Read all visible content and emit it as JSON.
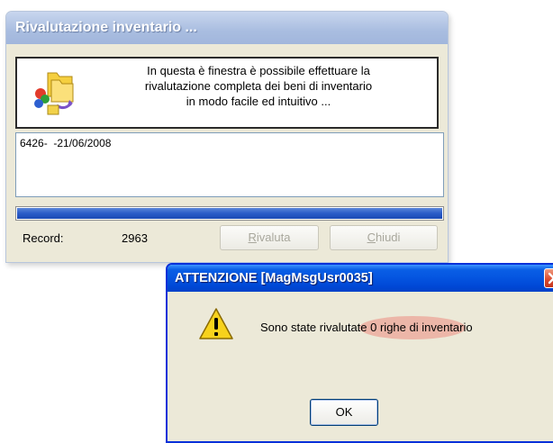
{
  "main_window": {
    "title": "Rivalutazione inventario ...",
    "info_line1": "In questa è finestra è possibile effettuare la",
    "info_line2": "rivalutazione completa dei beni di inventario",
    "info_line3": "in modo facile ed intuitivo ...",
    "info_icon": "folders-wizard-icon",
    "log_text": "6426-  -21/06/2008",
    "progress_fraction": 1.0,
    "record_label": "Record:",
    "record_value": "2963",
    "rivaluta_underlined": "R",
    "rivaluta_rest": "ivaluta",
    "chiudi_underlined": "C",
    "chiudi_rest": "hiudi"
  },
  "dialog": {
    "title": "ATTENZIONE [MagMsgUsr0035]",
    "message": "Sono state rivalutate 0 righe di inventario",
    "warning_icon": "warning-icon",
    "ok_label": "OK",
    "close_icon": "close-icon"
  },
  "colors": {
    "dialog_title_blue": "#0454e0",
    "highlight": "#ec8c82",
    "progress_blue": "#2a5bc8"
  }
}
